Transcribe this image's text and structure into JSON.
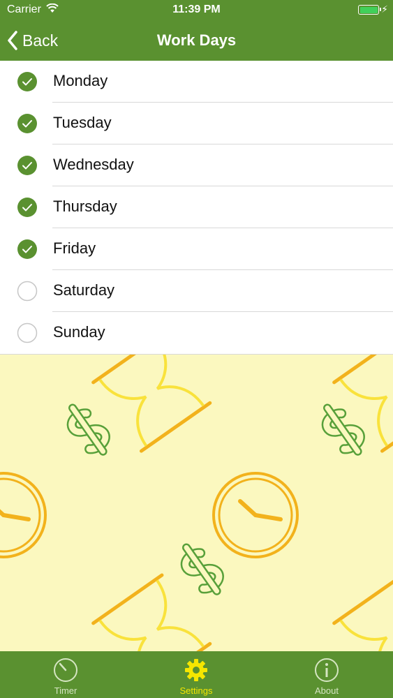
{
  "status_bar": {
    "carrier": "Carrier",
    "time": "11:39 PM",
    "battery_color": "#41d05a"
  },
  "nav": {
    "back_label": "Back",
    "title": "Work Days",
    "bar_color": "#5a9130"
  },
  "days": [
    {
      "label": "Monday",
      "checked": true
    },
    {
      "label": "Tuesday",
      "checked": true
    },
    {
      "label": "Wednesday",
      "checked": true
    },
    {
      "label": "Thursday",
      "checked": true
    },
    {
      "label": "Friday",
      "checked": true
    },
    {
      "label": "Saturday",
      "checked": false
    },
    {
      "label": "Sunday",
      "checked": false
    }
  ],
  "tabs": [
    {
      "label": "Timer",
      "icon": "timer-icon",
      "active": false
    },
    {
      "label": "Settings",
      "icon": "gear-icon",
      "active": true
    },
    {
      "label": "About",
      "icon": "info-icon",
      "active": false
    }
  ],
  "colors": {
    "check_fill": "#5a9130",
    "active_tab": "#f5e600",
    "pattern_bg": "#fbf8bf"
  }
}
